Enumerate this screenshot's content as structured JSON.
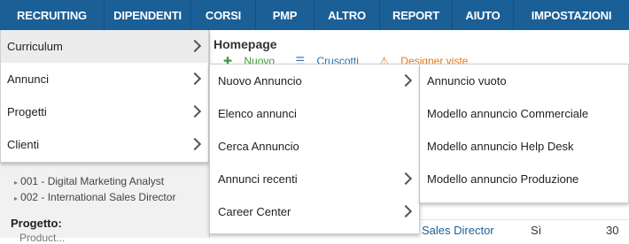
{
  "topnav": {
    "items": [
      {
        "label": "RECRUITING"
      },
      {
        "label": "DIPENDENTI"
      },
      {
        "label": "CORSI"
      },
      {
        "label": "PMP"
      },
      {
        "label": "ALTRO"
      },
      {
        "label": "REPORT"
      },
      {
        "label": "AIUTO"
      },
      {
        "label": "IMPOSTAZIONI"
      }
    ],
    "background_color": "#1b5f97"
  },
  "background_page": {
    "homepage_title": "Homepage",
    "actions": {
      "new_label": "Nuovo",
      "dashboard_label": "Cruscotti",
      "designer_label": "Designer viste"
    },
    "recent_items": [
      "001 - Digital Marketing Analyst",
      "002 - International Sales Director"
    ],
    "project_label": "Progetto:",
    "project_sub": "Product...",
    "table_row": {
      "link": "Sales Director",
      "flag": "Sì",
      "number": "30"
    }
  },
  "menu_level1": {
    "items": [
      {
        "label": "Curriculum",
        "active": true
      },
      {
        "label": "Annunci"
      },
      {
        "label": "Progetti"
      },
      {
        "label": "Clienti"
      }
    ]
  },
  "menu_level2": {
    "items": [
      {
        "label": "Nuovo Annuncio",
        "has_submenu": true
      },
      {
        "label": "Elenco annunci"
      },
      {
        "label": "Cerca Annuncio"
      },
      {
        "label": "Annunci recenti",
        "has_submenu": true
      },
      {
        "label": "Career Center",
        "has_submenu": true
      }
    ]
  },
  "menu_level3": {
    "items": [
      {
        "label": "Annuncio vuoto"
      },
      {
        "label": "Modello annuncio Commerciale"
      },
      {
        "label": "Modello annuncio Help Desk"
      },
      {
        "label": "Modello annuncio Produzione"
      }
    ]
  }
}
